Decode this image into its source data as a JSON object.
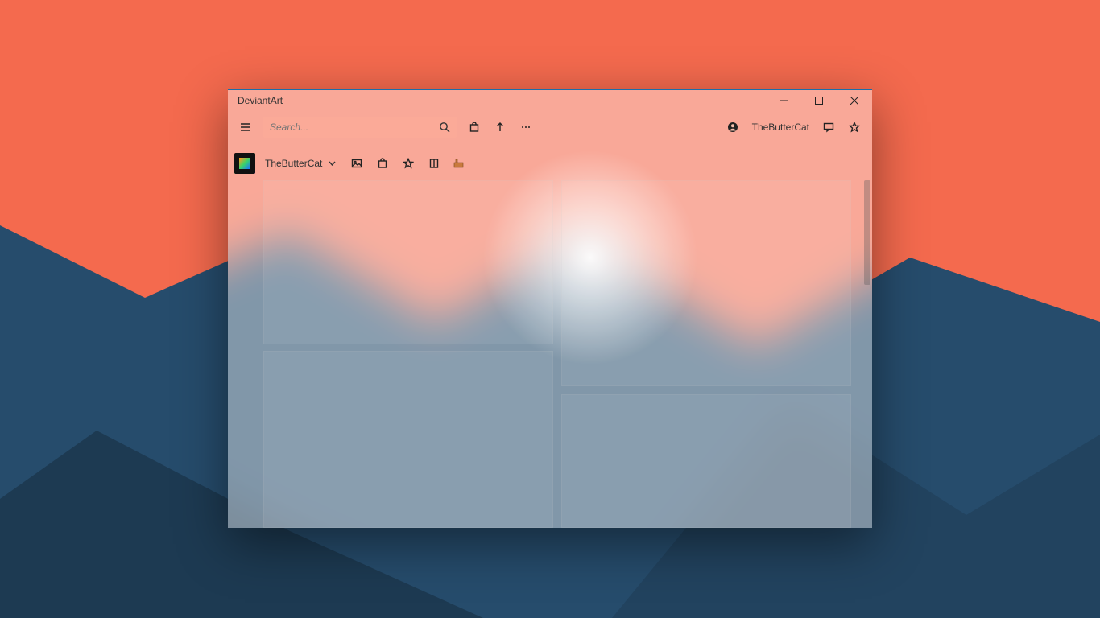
{
  "window": {
    "title": "DeviantArt"
  },
  "toolbar": {
    "search_placeholder": "Search..."
  },
  "user": {
    "name": "TheButterCat"
  },
  "tabrow": {
    "profile_name": "TheButterCat"
  }
}
